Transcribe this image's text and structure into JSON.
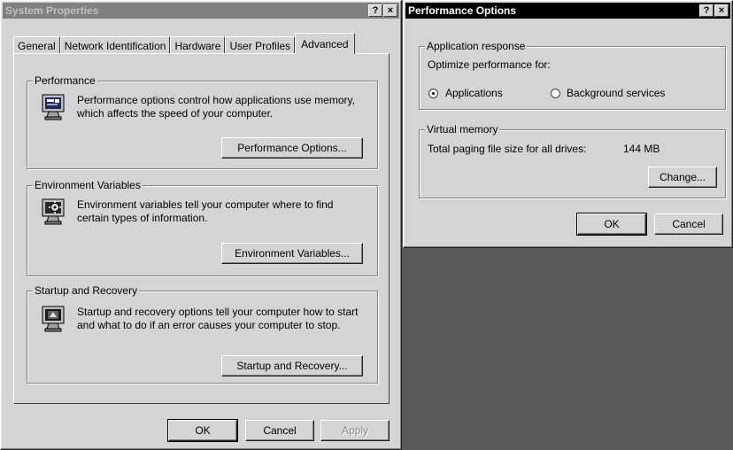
{
  "system_properties": {
    "title": "System Properties",
    "help_button": "?",
    "close_button": "×",
    "tabs": [
      {
        "label": "General"
      },
      {
        "label": "Network Identification"
      },
      {
        "label": "Hardware"
      },
      {
        "label": "User Profiles"
      },
      {
        "label": "Advanced"
      }
    ],
    "performance": {
      "group_label": "Performance",
      "description": "Performance options control how applications use memory, which affects the speed of your computer.",
      "button": "Performance Options..."
    },
    "environment": {
      "group_label": "Environment Variables",
      "description": "Environment variables tell your computer where to find certain types of information.",
      "button": "Environment Variables..."
    },
    "startup": {
      "group_label": "Startup and Recovery",
      "description": "Startup and recovery options tell your computer how to start and what to do if an error causes your computer to stop.",
      "button": "Startup and Recovery..."
    },
    "ok": "OK",
    "cancel": "Cancel",
    "apply": "Apply"
  },
  "performance_options": {
    "title": "Performance Options",
    "help_button": "?",
    "close_button": "×",
    "app_response": {
      "group_label": "Application response",
      "optimize_label": "Optimize performance for:",
      "applications": "Applications",
      "background": "Background services",
      "selected": "Applications"
    },
    "virtual_memory": {
      "group_label": "Virtual memory",
      "total_label": "Total paging file size for all drives:",
      "total_value": "144 MB",
      "change_button": "Change..."
    },
    "ok": "OK",
    "cancel": "Cancel"
  }
}
